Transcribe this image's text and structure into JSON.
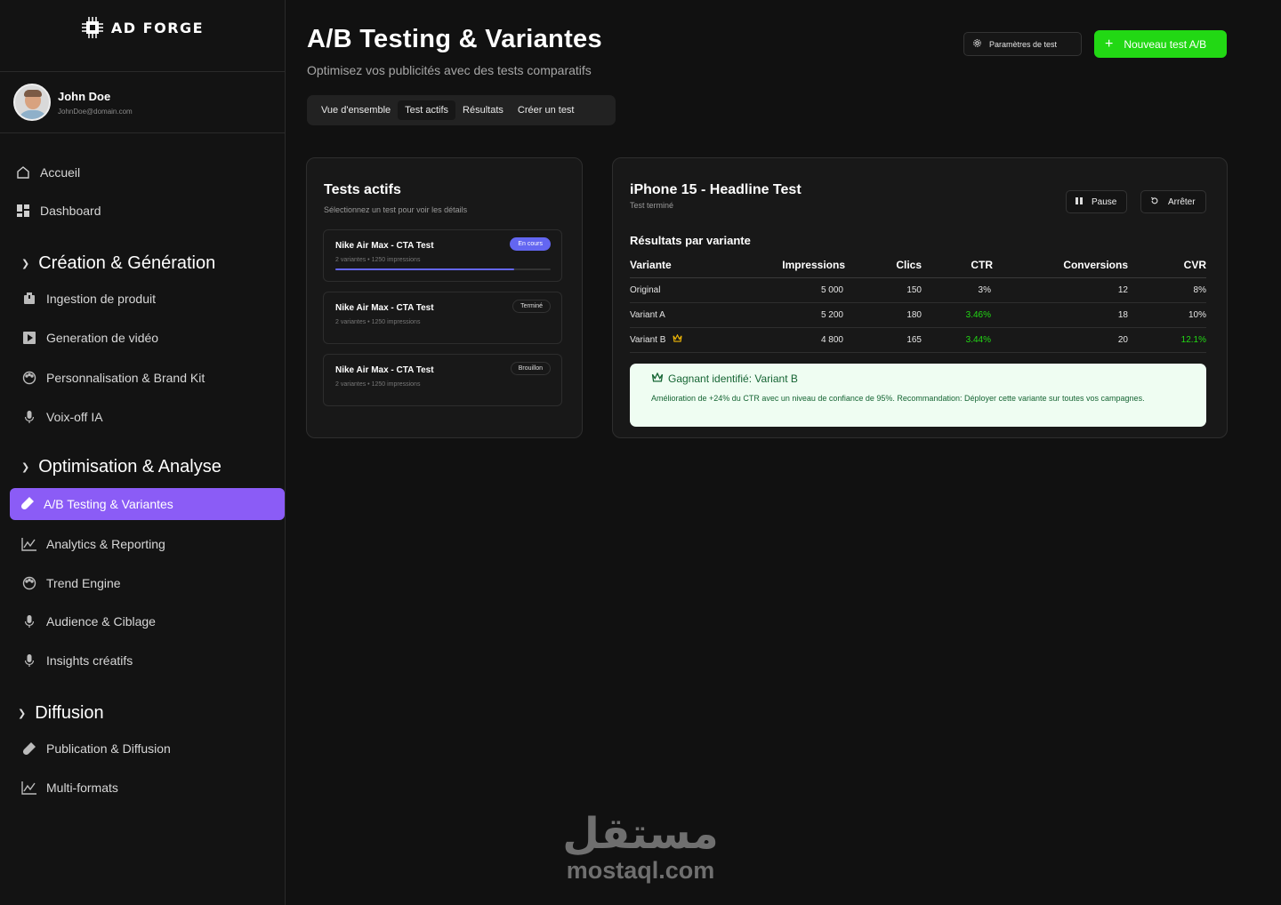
{
  "brand": {
    "name": "AD FORGE"
  },
  "user": {
    "name": "John Doe",
    "email": "JohnDoe@domain.com"
  },
  "sidebar": {
    "top_items": [
      {
        "label": "Accueil",
        "icon": "home-icon"
      },
      {
        "label": "Dashboard",
        "icon": "dashboard-icon"
      }
    ],
    "sections": [
      {
        "title": "Création & Génération",
        "items": [
          "Ingestion de produit",
          "Generation de vidéo",
          "Personnalisation & Brand Kit",
          "Voix-off IA"
        ]
      },
      {
        "title": "Optimisation & Analyse",
        "items": [
          "A/B Testing & Variantes",
          "Analytics & Reporting",
          "Trend Engine",
          "Audience & Ciblage",
          "Insights créatifs"
        ]
      },
      {
        "title": "Diffusion",
        "items": [
          "Publication & Diffusion",
          "Multi-formats"
        ]
      }
    ],
    "active_item": "A/B Testing & Variantes"
  },
  "header": {
    "title": "A/B Testing & Variantes",
    "subtitle": "Optimisez vos publicités avec des tests comparatifs",
    "settings_label": "Paramètres de test",
    "new_test_label": "Nouveau test A/B",
    "accent_color": "#22d814"
  },
  "tabs": [
    {
      "label": "Vue d'ensemble",
      "active": false
    },
    {
      "label": "Test actifs",
      "active": true
    },
    {
      "label": "Résultats",
      "active": false
    },
    {
      "label": "Créer un test",
      "active": false
    }
  ],
  "tests_panel": {
    "title": "Tests actifs",
    "subtitle": "Sélectionnez un test pour voir les détails",
    "tests": [
      {
        "name": "Nike Air Max - CTA Test",
        "meta": "2 variantes • 1250 impressions",
        "status": "En cours",
        "progress": 0.83
      },
      {
        "name": "Nike Air Max - CTA Test",
        "meta": "2 variantes • 1250 impressions",
        "status": "Terminé"
      },
      {
        "name": "Nike Air Max - CTA Test",
        "meta": "2 variantes • 1250 impressions",
        "status": "Brouillon"
      }
    ]
  },
  "detail": {
    "title": "iPhone 15 - Headline Test",
    "status": "Test terminé",
    "pause_label": "Pause",
    "stop_label": "Arrêter",
    "results_title": "Résultats par variante",
    "columns": [
      "Variante",
      "Impressions",
      "Clics",
      "CTR",
      "Conversions",
      "CVR"
    ],
    "rows": [
      {
        "variant": "Original",
        "impressions": "5 000",
        "clicks": "150",
        "ctr": "3%",
        "conversions": "12",
        "cvr": "8%",
        "ctr_highlight": false,
        "cvr_highlight": false,
        "winner": false
      },
      {
        "variant": "Variant A",
        "impressions": "5 200",
        "clicks": "180",
        "ctr": "3.46%",
        "conversions": "18",
        "cvr": "10%",
        "ctr_highlight": true,
        "cvr_highlight": false,
        "winner": false
      },
      {
        "variant": "Variant B",
        "impressions": "4 800",
        "clicks": "165",
        "ctr": "3.44%",
        "conversions": "20",
        "cvr": "12.1%",
        "ctr_highlight": true,
        "cvr_highlight": true,
        "winner": true
      }
    ],
    "winner_title": "Gagnant identifié: Variant B",
    "winner_text": "Amélioration de +24% du CTR avec un niveau de confiance de 95%. Recommandation: Déployer cette variante sur toutes vos campagnes."
  },
  "watermark": {
    "arabic": "مستقل",
    "latin": "mostaql.com"
  }
}
